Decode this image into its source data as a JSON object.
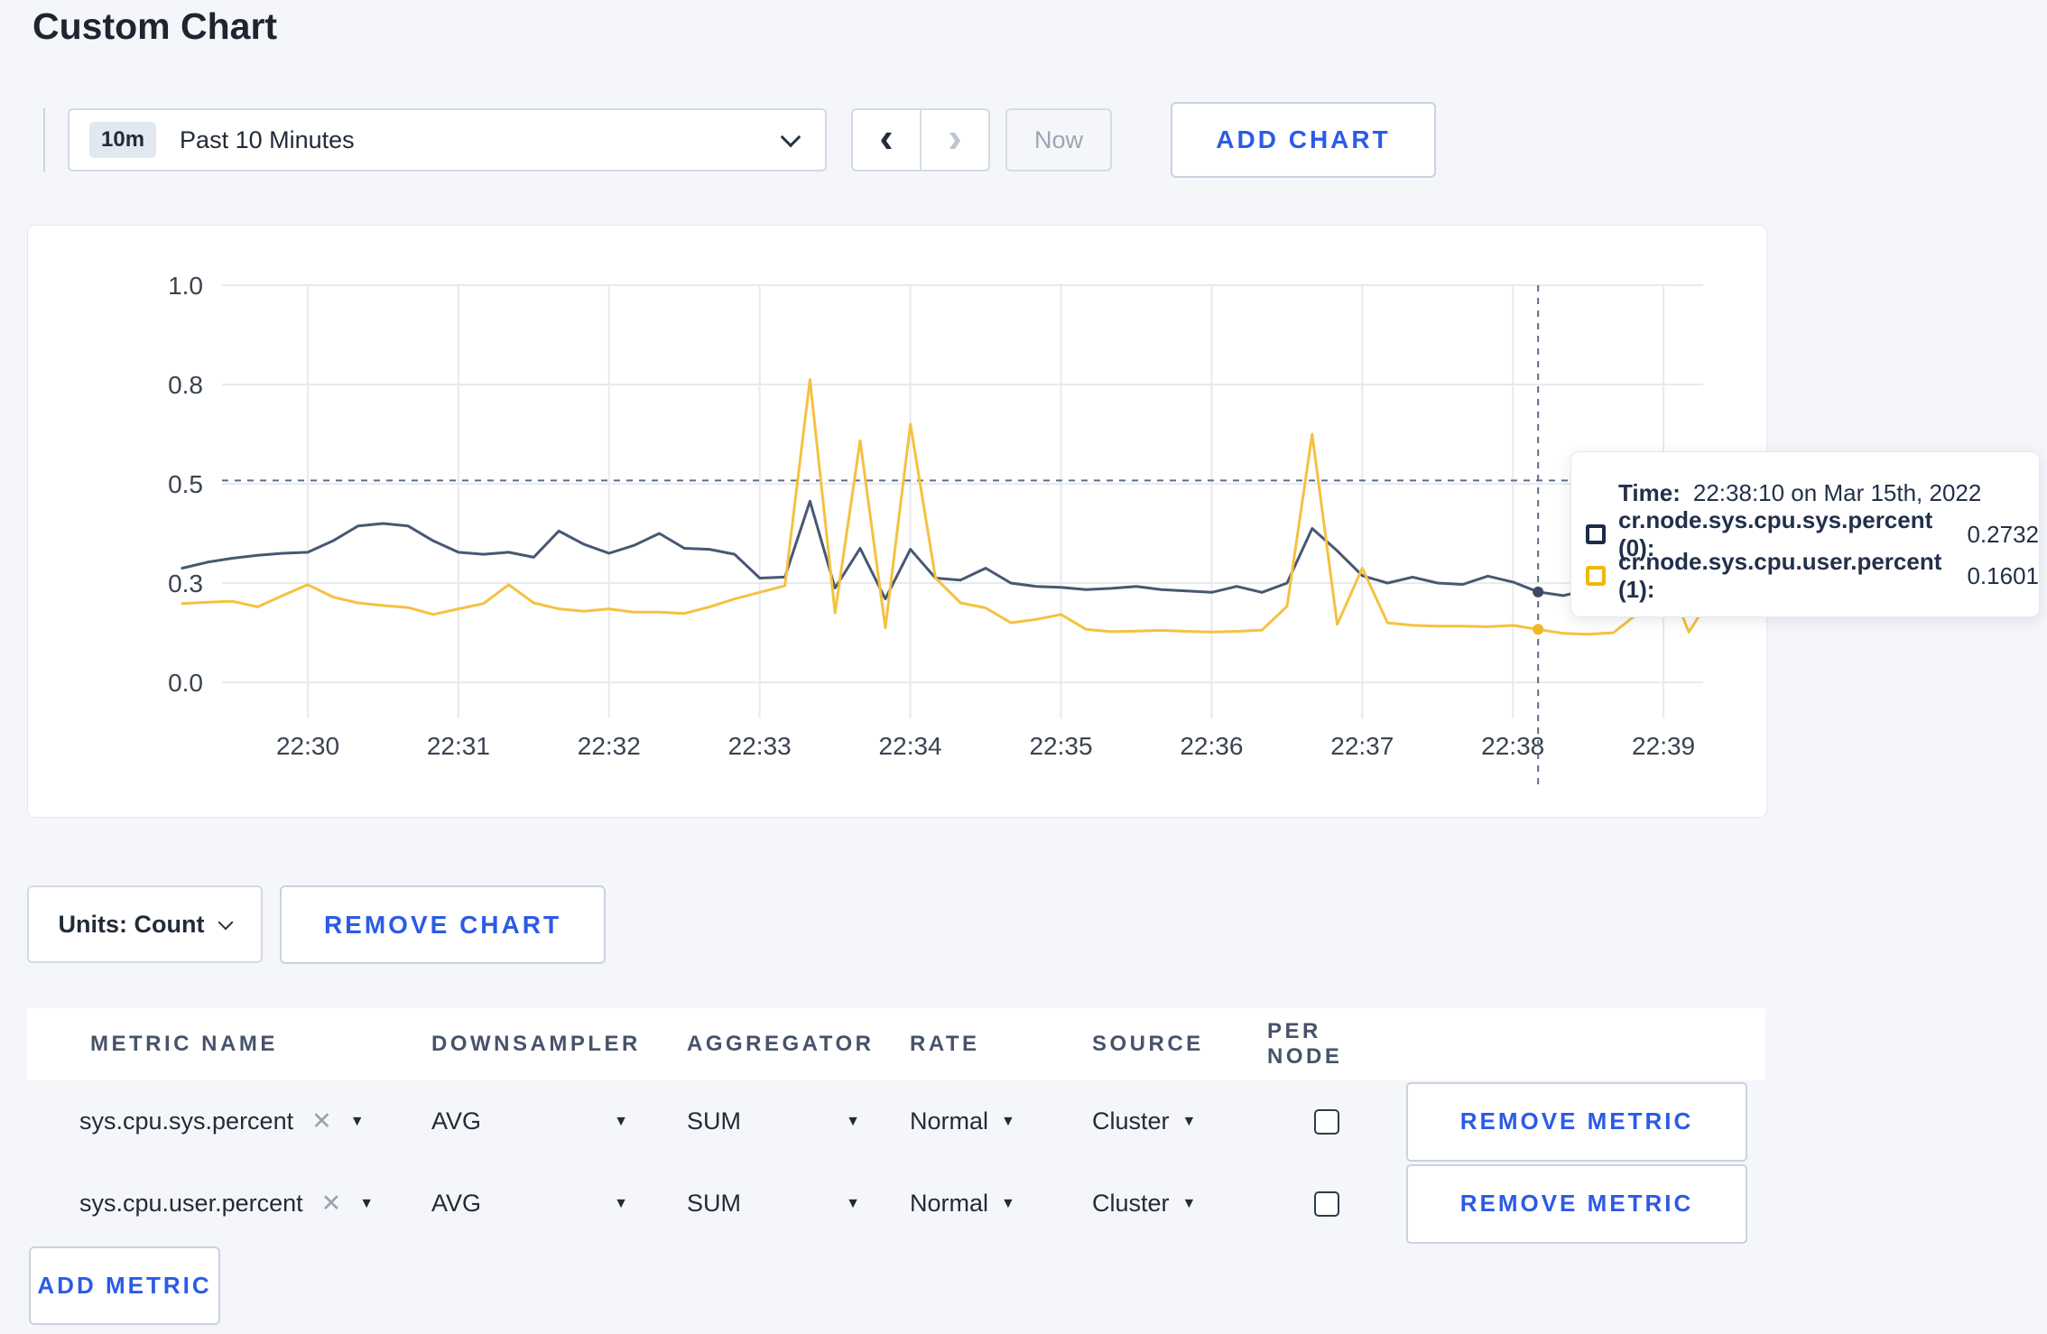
{
  "page": {
    "title": "Custom Chart"
  },
  "colors": {
    "accent_blue": "#2b5be6",
    "page_bg": "#f5f6fa",
    "series_sys": "#475872",
    "series_user": "#f5c140",
    "swatch_sys": "#1b2b4a",
    "swatch_user": "#f2b70a",
    "grid": "#e8eaee",
    "crosshair": "#5a6e87",
    "axis_text": "#3a4350"
  },
  "icons": {
    "caret_down": "▼",
    "close": "✕",
    "chevron_left": "‹",
    "chevron_right": "›"
  },
  "toolbar": {
    "time_badge": "10m",
    "time_label": "Past 10 Minutes",
    "now_label": "Now",
    "add_chart_label": "ADD CHART"
  },
  "tooltip": {
    "time_label": "Time:",
    "time_value": "22:38:10 on Mar 15th, 2022",
    "series": [
      {
        "name": "cr.node.sys.cpu.sys.percent (0):",
        "value": "0.2732",
        "color": "#1b2b4a"
      },
      {
        "name": "cr.node.sys.cpu.user.percent (1):",
        "value": "0.1601",
        "color": "#f2b70a"
      }
    ]
  },
  "chart_controls": {
    "units_label": "Units: Count",
    "remove_chart_label": "REMOVE CHART",
    "add_metric_label": "ADD METRIC"
  },
  "metrics_table": {
    "headers": [
      "METRIC NAME",
      "DOWNSAMPLER",
      "AGGREGATOR",
      "RATE",
      "SOURCE",
      "PER NODE"
    ],
    "rows": [
      {
        "metric": "sys.cpu.sys.percent",
        "downsampler": "AVG",
        "aggregator": "SUM",
        "rate": "Normal",
        "source": "Cluster",
        "per_node_checked": false,
        "remove_label": "REMOVE METRIC"
      },
      {
        "metric": "sys.cpu.user.percent",
        "downsampler": "AVG",
        "aggregator": "SUM",
        "rate": "Normal",
        "source": "Cluster",
        "per_node_checked": false,
        "remove_label": "REMOVE METRIC"
      }
    ]
  },
  "chart_data": {
    "type": "line",
    "title": "",
    "xlabel": "",
    "ylabel": "",
    "x_ticks": [
      "22:30",
      "22:31",
      "22:32",
      "22:33",
      "22:34",
      "22:35",
      "22:36",
      "22:37",
      "22:38",
      "22:39"
    ],
    "y_ticks": [
      {
        "label": "0.0",
        "v": 0.0
      },
      {
        "label": "0.3",
        "v": 0.3
      },
      {
        "label": "0.5",
        "v": 0.5
      },
      {
        "label": "0.8",
        "v": 0.8
      },
      {
        "label": "1.0",
        "v": 1.0
      }
    ],
    "y_scale_note": "ticks evenly spaced on screen (piecewise-linear axis)",
    "x_start_time": "22:29:10",
    "x_interval_seconds": 10,
    "grid": true,
    "legend_position": "tooltip",
    "hover": {
      "index": 54,
      "time": "22:38:10 on Mar 15th, 2022",
      "hline_value": 0.51
    },
    "series": [
      {
        "name": "cr.node.sys.cpu.sys.percent",
        "color": "#475872",
        "values": [
          0.33,
          0.342,
          0.35,
          0.356,
          0.36,
          0.362,
          0.385,
          0.415,
          0.42,
          0.415,
          0.385,
          0.362,
          0.358,
          0.362,
          0.352,
          0.405,
          0.378,
          0.36,
          0.376,
          0.4,
          0.37,
          0.368,
          0.358,
          0.31,
          0.312,
          0.465,
          0.285,
          0.37,
          0.252,
          0.368,
          0.31,
          0.306,
          0.33,
          0.3,
          0.29,
          0.287,
          0.28,
          0.284,
          0.29,
          0.28,
          0.276,
          0.272,
          0.29,
          0.272,
          0.3,
          0.41,
          0.365,
          0.315,
          0.3,
          0.312,
          0.3,
          0.296,
          0.314,
          0.302,
          0.2732,
          0.262,
          0.28,
          0.3,
          0.296,
          0.3,
          0.3,
          0.303
        ]
      },
      {
        "name": "cr.node.sys.cpu.user.percent",
        "color": "#f5c140",
        "values": [
          0.238,
          0.242,
          0.245,
          0.228,
          0.262,
          0.295,
          0.258,
          0.24,
          0.232,
          0.226,
          0.205,
          0.222,
          0.238,
          0.295,
          0.24,
          0.222,
          0.215,
          0.222,
          0.212,
          0.212,
          0.208,
          0.228,
          0.252,
          0.272,
          0.292,
          0.81,
          0.21,
          0.63,
          0.165,
          0.68,
          0.31,
          0.24,
          0.225,
          0.18,
          0.19,
          0.205,
          0.16,
          0.153,
          0.155,
          0.157,
          0.154,
          0.152,
          0.154,
          0.158,
          0.23,
          0.65,
          0.175,
          0.33,
          0.18,
          0.172,
          0.17,
          0.17,
          0.168,
          0.172,
          0.1601,
          0.148,
          0.145,
          0.15,
          0.21,
          0.33,
          0.152,
          0.27
        ]
      }
    ]
  }
}
